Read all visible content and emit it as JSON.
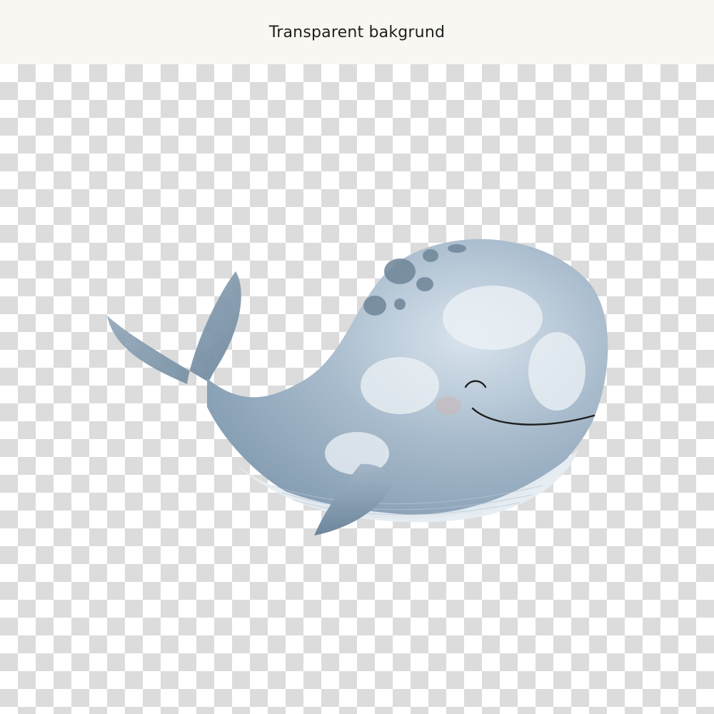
{
  "header": {
    "title": "Transparent bakgrund"
  },
  "canvas": {
    "background": "checkerboard",
    "checker_light": "#ffffff",
    "checker_dark": "#dcdcdc"
  },
  "artwork": {
    "subject": "whale-illustration",
    "body_color": "#8fa6ba",
    "belly_color": "#e4ebf0",
    "spot_color": "#6f8699"
  }
}
